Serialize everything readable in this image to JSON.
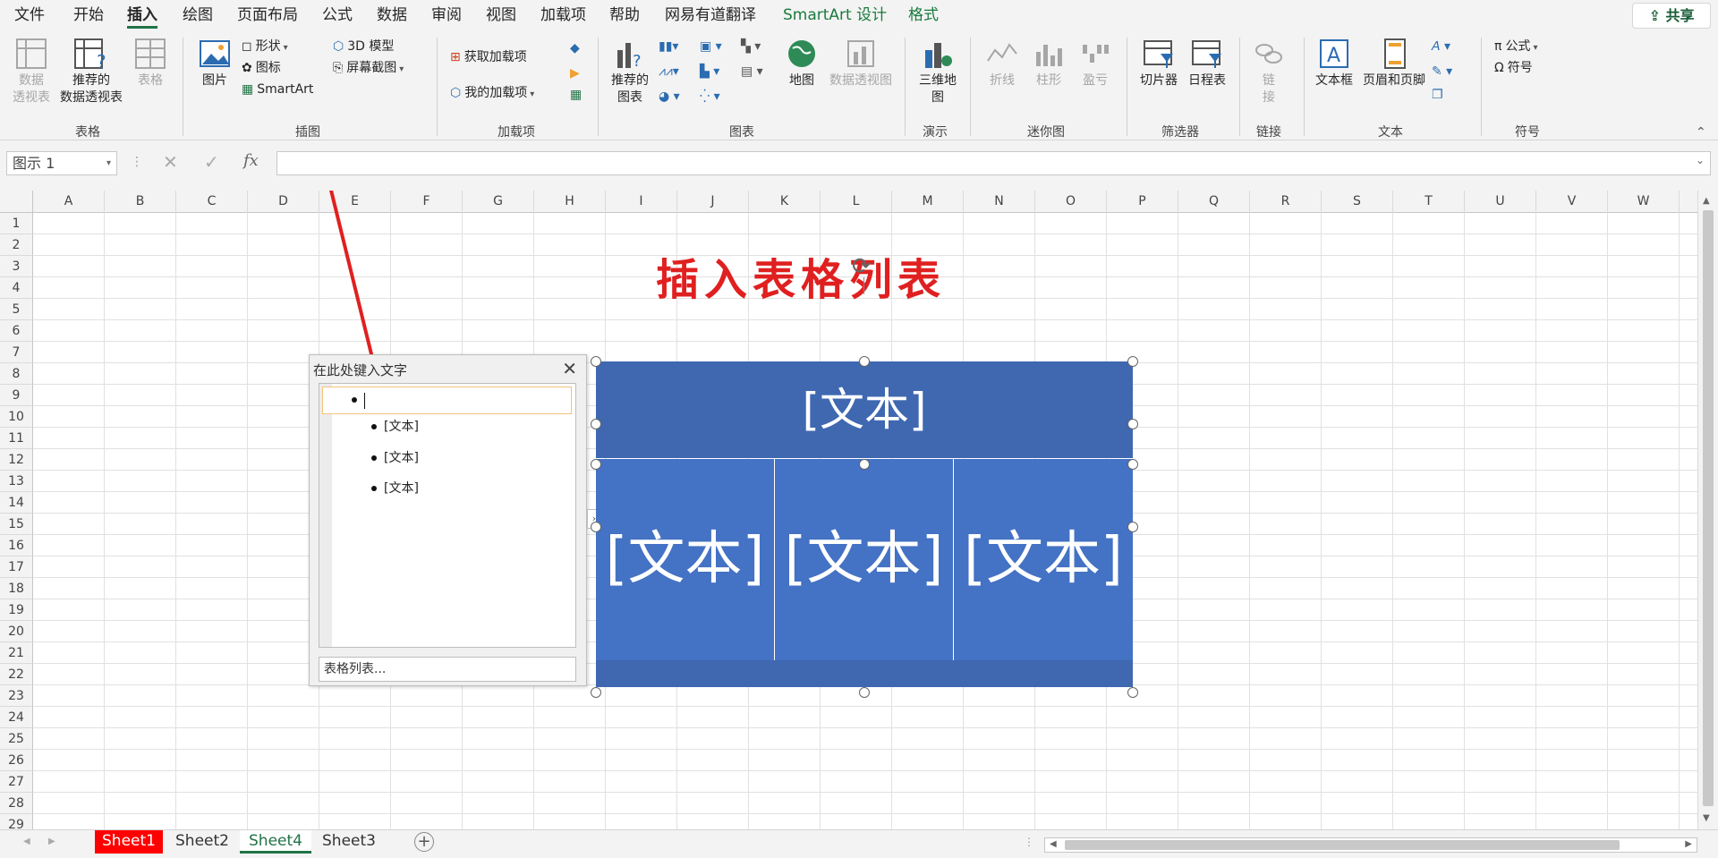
{
  "menu": {
    "tabs": [
      "文件",
      "开始",
      "插入",
      "绘图",
      "页面布局",
      "公式",
      "数据",
      "审阅",
      "视图",
      "加载项",
      "帮助",
      "网易有道翻译",
      "SmartArt 设计",
      "格式"
    ],
    "active": "插入",
    "share": "共享"
  },
  "ribbon": {
    "tables": {
      "pivot": "数据\n透视表",
      "recommended_pivot": "推荐的\n数据透视表",
      "table": "表格",
      "group": "表格"
    },
    "illustrations": {
      "picture": "图片",
      "shapes": "形状",
      "icons": "图标",
      "model3d": "3D 模型",
      "screenshot": "屏幕截图",
      "smartart": "SmartArt",
      "group": "插图"
    },
    "addins": {
      "get": "获取加载项",
      "my": "我的加载项",
      "group": "加载项"
    },
    "charts": {
      "recommended": "推荐的\n图表",
      "map": "地图",
      "pivotchart": "数据透视图",
      "group": "图表"
    },
    "tours": {
      "map3d": "三维地\n图",
      "group": "演示"
    },
    "sparklines": {
      "line": "折线",
      "column": "柱形",
      "winloss": "盈亏",
      "group": "迷你图"
    },
    "filters": {
      "slicer": "切片器",
      "timeline": "日程表",
      "group": "筛选器"
    },
    "links": {
      "link": "链\n接",
      "group": "链接"
    },
    "text": {
      "textbox": "文本框",
      "headerfooter": "页眉和页脚",
      "group": "文本"
    },
    "symbols": {
      "equation": "公式",
      "symbol": "符号",
      "group": "符号"
    }
  },
  "formula_bar": {
    "name_box": "图示 1",
    "value": ""
  },
  "columns": [
    "A",
    "B",
    "C",
    "D",
    "E",
    "F",
    "G",
    "H",
    "I",
    "J",
    "K",
    "L",
    "M",
    "N",
    "O",
    "P",
    "Q",
    "R",
    "S",
    "T",
    "U",
    "V",
    "W"
  ],
  "rows": [
    "1",
    "2",
    "3",
    "4",
    "5",
    "6",
    "7",
    "8",
    "9",
    "10",
    "11",
    "12",
    "13",
    "14",
    "15",
    "16",
    "17",
    "18",
    "19",
    "20",
    "21",
    "22",
    "23",
    "24",
    "25",
    "26",
    "27",
    "28",
    "29"
  ],
  "annotation_title": "插入表格列表",
  "text_pane": {
    "title": "在此处键入文字",
    "items": [
      "[文本]",
      "[文本]",
      "[文本]"
    ],
    "footer_link": "表格列表..."
  },
  "smartart": {
    "top": "[文本]",
    "cells": [
      "[文本]",
      "[文本]",
      "[文本]"
    ],
    "fill_top": "#3f68b1",
    "fill_cells": "#4472c4"
  },
  "sheet_tabs": {
    "tabs": [
      "Sheet1",
      "Sheet2",
      "Sheet4",
      "Sheet3"
    ],
    "active": "Sheet4",
    "highlighted": "Sheet1"
  },
  "colors": {
    "accent": "#217346",
    "annotation": "#e02020"
  }
}
